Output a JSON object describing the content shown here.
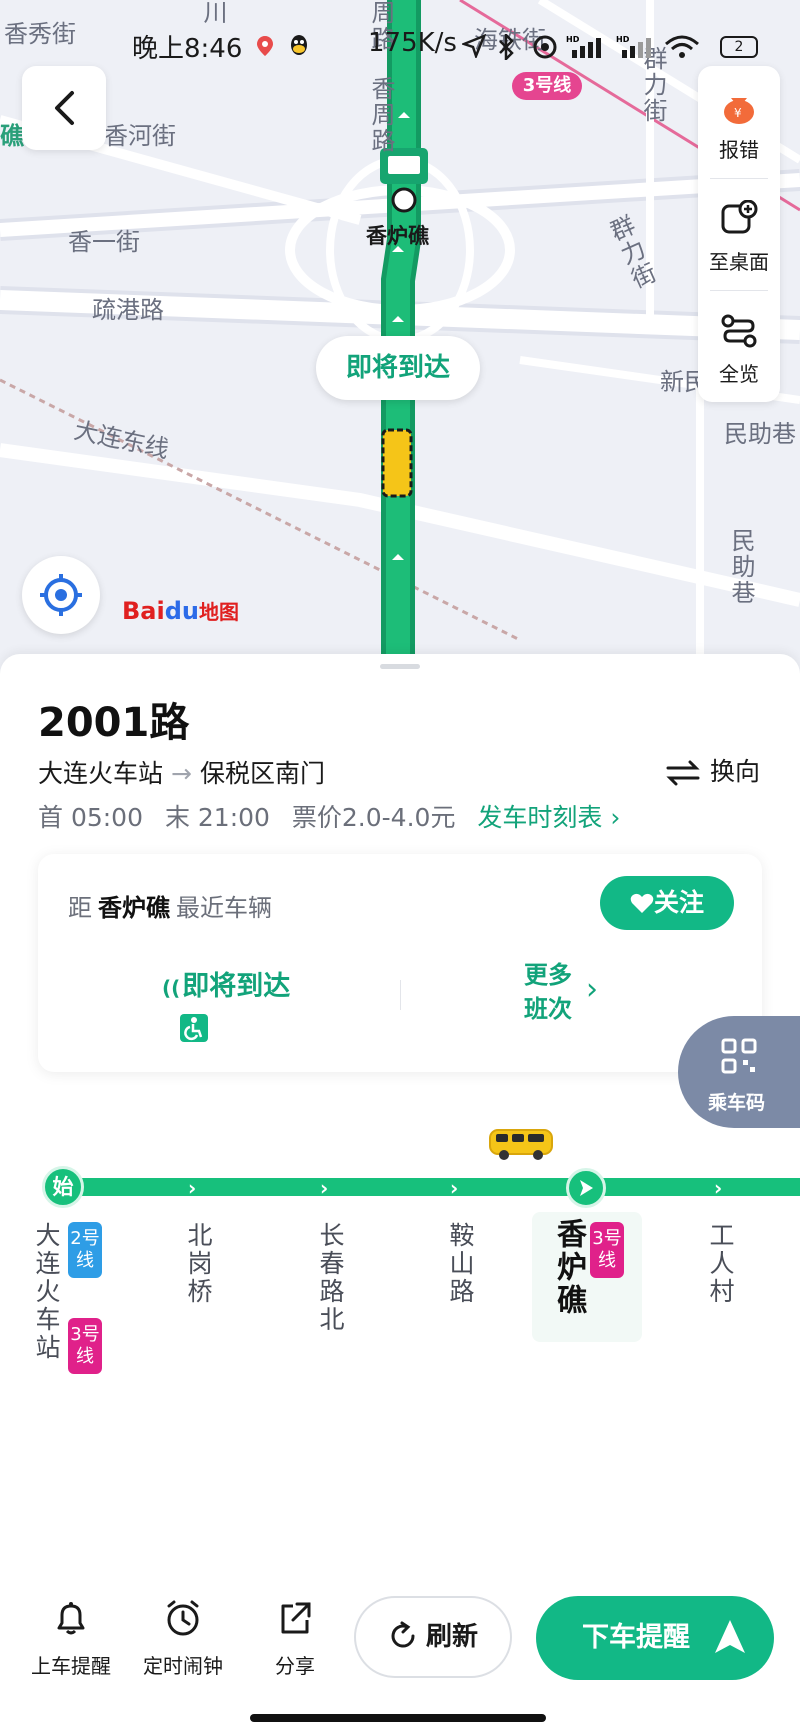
{
  "status_bar": {
    "time": "晚上8:46",
    "network_speed": "175K/s",
    "battery": "2"
  },
  "map": {
    "rail_badge": "3号线",
    "labels": {
      "xiangxiu": "香秀街",
      "chuan": "川",
      "xianghe": "香河街",
      "xiangyi": "香一街",
      "shugang": "疏港路",
      "dalian_east": "大连东线",
      "jiao": "礁",
      "xiangzhou": "香周路",
      "zhoulu": "周路",
      "haitie": "海铁街",
      "qunli": "群力街",
      "qunli2": "群力街",
      "xinmin": "新民",
      "minzhu": "民助巷",
      "minzhu_v": "民助巷"
    },
    "stop_label": "香炉礁",
    "arriving_bubble": "即将到达",
    "logo": {
      "bai": "Bai",
      "du": "du",
      "map": "地图"
    }
  },
  "tools": {
    "report": "报错",
    "desktop": "至桌面",
    "overview": "全览"
  },
  "route": {
    "name": "2001路",
    "from": "大连火车站",
    "to": "保税区南门",
    "swap_label": "换向",
    "first": "首 05:00",
    "last": "末 21:00",
    "fare": "票价2.0-4.0元",
    "timetable": "发车时刻表"
  },
  "card": {
    "prefix": "距",
    "stop": "香炉礁",
    "suffix": "最近车辆",
    "follow": "关注",
    "arriving": "即将到达",
    "more_trips": "更多班次"
  },
  "ride_code": "乘车码",
  "stops": {
    "start_marker": "始",
    "list": [
      {
        "name": "大连火车站"
      },
      {
        "name": "北岗桥"
      },
      {
        "name": "长春路北"
      },
      {
        "name": "鞍山路"
      },
      {
        "name": "香炉礁"
      },
      {
        "name": "工人村"
      }
    ],
    "metro": {
      "l2": "2号线",
      "l3": "3号线"
    }
  },
  "bottom_bar": {
    "board_alert": "上车提醒",
    "alarm": "定时闹钟",
    "share": "分享",
    "refresh": "刷新",
    "alight_alert": "下车提醒"
  },
  "colors": {
    "accent": "#12b886",
    "route_line": "#17c07c",
    "metro_line_2": "#2e9de6",
    "metro_line_3": "#e0218a",
    "bus": "#f5c518"
  }
}
